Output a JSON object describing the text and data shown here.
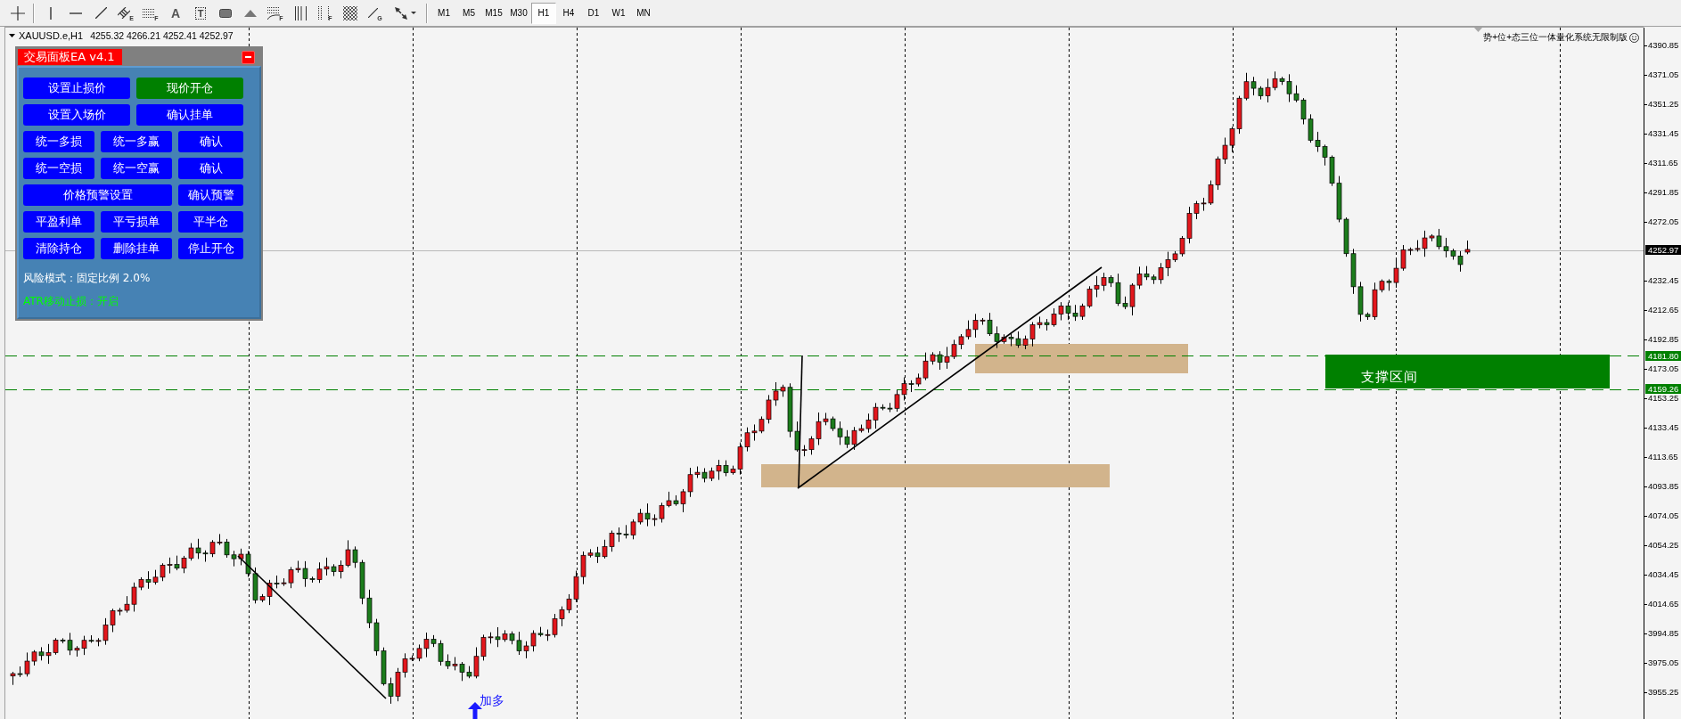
{
  "toolbar": {
    "tool_groups": [
      {
        "tools": [
          {
            "kind": "crosshair"
          }
        ]
      },
      {
        "tools": [
          {
            "kind": "vline"
          },
          {
            "kind": "hline"
          },
          {
            "kind": "trendline"
          },
          {
            "kind": "channel",
            "badge": "E"
          },
          {
            "kind": "fibo-lines",
            "badge": "F"
          },
          {
            "kind": "text",
            "glyph": "A"
          },
          {
            "kind": "label",
            "glyph": "T"
          },
          {
            "kind": "rectangle"
          },
          {
            "kind": "triangle"
          },
          {
            "kind": "fibo-arcs",
            "badge": "F"
          },
          {
            "kind": "cycle-lines"
          },
          {
            "kind": "fibo-time",
            "badge": "F"
          },
          {
            "kind": "gann-grid"
          },
          {
            "kind": "gann-line",
            "badge": "G"
          },
          {
            "kind": "arrows"
          }
        ]
      }
    ],
    "timeframes": [
      {
        "label": "M1",
        "selected": false
      },
      {
        "label": "M5",
        "selected": false
      },
      {
        "label": "M15",
        "selected": false
      },
      {
        "label": "M30",
        "selected": false
      },
      {
        "label": "H1",
        "selected": true
      },
      {
        "label": "H4",
        "selected": false
      },
      {
        "label": "D1",
        "selected": false
      },
      {
        "label": "W1",
        "selected": false
      },
      {
        "label": "MN",
        "selected": false
      }
    ]
  },
  "chart": {
    "symbol": "XAUUSD.e,H1",
    "ohlc": "4255.32 4266.21 4252.41 4252.97",
    "indicator_title": "势+位+态三位一体量化系统无限制版",
    "support_zone": {
      "label": "支撑区间"
    },
    "signal": {
      "label": "加多"
    }
  },
  "panel": {
    "title": "交易面板EA v4.1",
    "rows": [
      {
        "kind": "halves",
        "buttons": [
          {
            "label": "设置止损价",
            "color": "#0000ff"
          },
          {
            "label": "现价开仓",
            "color": "#008000"
          }
        ]
      },
      {
        "kind": "halves",
        "buttons": [
          {
            "label": "设置入场价",
            "color": "#0000ff"
          },
          {
            "label": "确认挂单",
            "color": "#0000ff"
          }
        ]
      },
      {
        "kind": "thirds",
        "buttons": [
          {
            "label": "统一多损",
            "color": "#0000ff"
          },
          {
            "label": "统一多赢",
            "color": "#0000ff"
          },
          {
            "label": "确认",
            "color": "#0000ff"
          }
        ]
      },
      {
        "kind": "thirds",
        "buttons": [
          {
            "label": "统一空损",
            "color": "#0000ff"
          },
          {
            "label": "统一空赢",
            "color": "#0000ff"
          },
          {
            "label": "确认",
            "color": "#0000ff"
          }
        ]
      },
      {
        "kind": "wide-first",
        "buttons": [
          {
            "label": "价格预警设置",
            "color": "#0000ff"
          },
          {
            "label": "确认预警",
            "color": "#0000ff"
          }
        ]
      },
      {
        "kind": "thirds",
        "buttons": [
          {
            "label": "平盈利单",
            "color": "#0000ff"
          },
          {
            "label": "平亏损单",
            "color": "#0000ff"
          },
          {
            "label": "平半仓",
            "color": "#0000ff"
          }
        ]
      },
      {
        "kind": "thirds",
        "buttons": [
          {
            "label": "清除持仓",
            "color": "#0000ff"
          },
          {
            "label": "删除挂单",
            "color": "#0000ff"
          },
          {
            "label": "停止开仓",
            "color": "#0000ff"
          }
        ]
      }
    ],
    "risk_mode": "风险模式：固定比例 2.0%",
    "atr_status": "ATR移动止损：开启"
  },
  "price_axis": {
    "ticks": [
      "4390.85",
      "4371.05",
      "4351.25",
      "4331.45",
      "4311.65",
      "4291.85",
      "4272.05",
      "4232.45",
      "4212.65",
      "4192.85",
      "4173.05",
      "4153.25",
      "4133.45",
      "4113.65",
      "4093.85",
      "4074.05",
      "4054.25",
      "4034.45",
      "4014.65",
      "3994.85",
      "3975.05",
      "3955.25"
    ],
    "markers": [
      {
        "label": "4252.97",
        "kind": "bid"
      },
      {
        "label": "4181.80",
        "kind": "level"
      },
      {
        "label": "4159.26",
        "kind": "level"
      }
    ]
  }
}
